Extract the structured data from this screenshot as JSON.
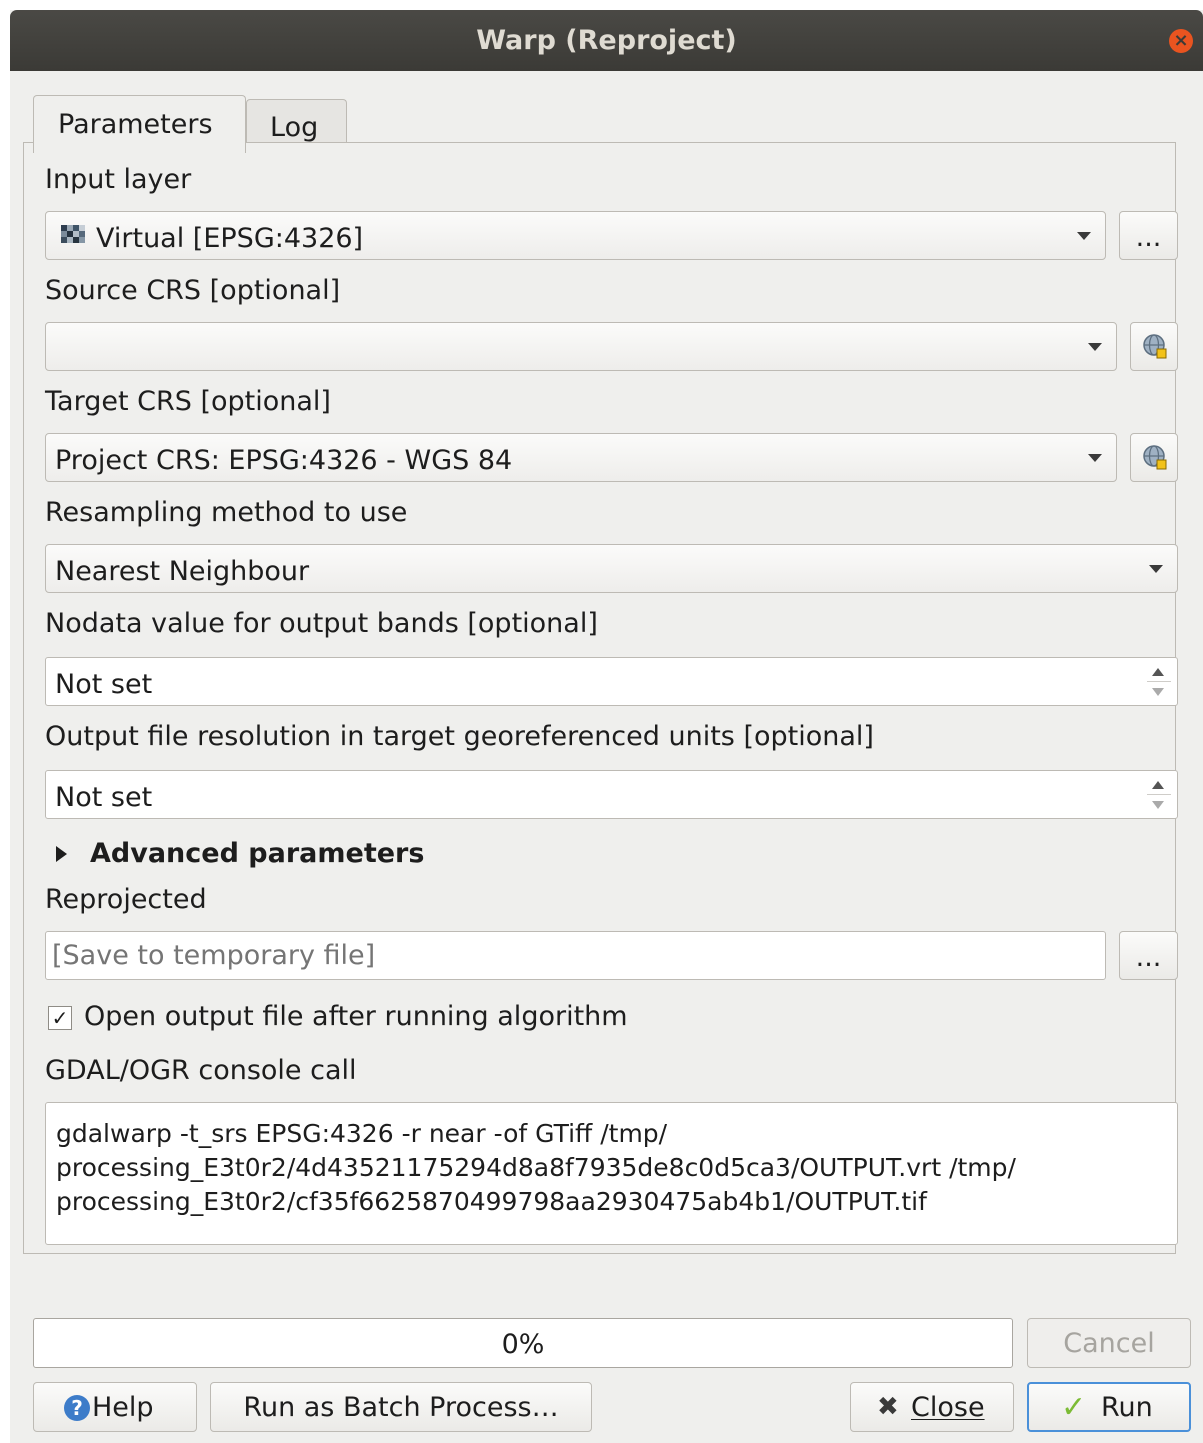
{
  "window": {
    "title": "Warp (Reproject)"
  },
  "tabs": [
    {
      "label": "Parameters"
    },
    {
      "label": "Log"
    }
  ],
  "params": {
    "input_layer": {
      "label": "Input layer",
      "value": "Virtual [EPSG:4326]",
      "browse": "..."
    },
    "source_crs": {
      "label": "Source CRS [optional]",
      "value": ""
    },
    "target_crs": {
      "label": "Target CRS [optional]",
      "value": "Project CRS: EPSG:4326 - WGS 84"
    },
    "resampling": {
      "label": "Resampling method to use",
      "value": "Nearest Neighbour"
    },
    "nodata": {
      "label": "Nodata value for output bands [optional]",
      "value": "Not set"
    },
    "resolution": {
      "label": "Output file resolution in target georeferenced units [optional]",
      "value": "Not set"
    },
    "advanced": {
      "label": "Advanced parameters"
    },
    "reprojected": {
      "label": "Reprojected",
      "placeholder": "[Save to temporary file]",
      "browse": "..."
    },
    "open_output": {
      "label": "Open output file after running algorithm",
      "checked": true,
      "check_glyph": "✓"
    },
    "console": {
      "label": "GDAL/OGR console call",
      "text": "gdalwarp -t_srs EPSG:4326 -r near -of GTiff /tmp/\nprocessing_E3t0r2/4d43521175294d8a8f7935de8c0d5ca3/OUTPUT.vrt /tmp/\nprocessing_E3t0r2/cf35f6625870499798aa2930475ab4b1/OUTPUT.tif"
    }
  },
  "footer": {
    "progress": {
      "value": 0,
      "text": "0%"
    },
    "cancel": "Cancel",
    "help": "Help",
    "batch": "Run as Batch Process…",
    "close": "Close",
    "run": "Run"
  },
  "icons": {
    "close_window": "close-icon",
    "raster_layer": "raster-layer-icon",
    "crs_selector": "globe-crs-icon",
    "expand": "triangle-right-icon",
    "help": "question-icon",
    "close": "x-icon",
    "run": "checkmark-icon"
  },
  "colors": {
    "titlebar": "#3b3a36",
    "close_accent": "#e95420",
    "run_border": "#4a90d9",
    "help_blue": "#3d7cc9",
    "run_check": "#7cbb35"
  }
}
